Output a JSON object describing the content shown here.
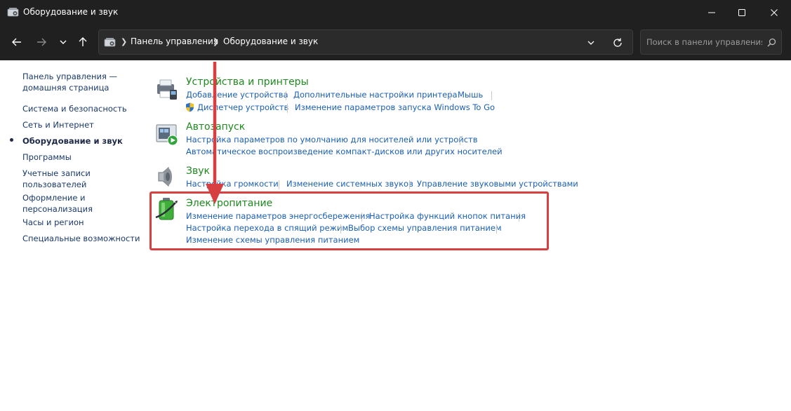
{
  "window": {
    "title": "Оборудование и звук"
  },
  "address": {
    "breadcrumbs": [
      "Панель управления",
      "Оборудование и звук"
    ]
  },
  "search": {
    "placeholder": "Поиск в панели управления"
  },
  "sidebar": {
    "items": [
      {
        "label": "Панель управления —\nдомашняя страница"
      },
      {
        "label": "Система и безопасность"
      },
      {
        "label": "Сеть и Интернет"
      },
      {
        "label": "Оборудование и звук",
        "current": true
      },
      {
        "label": "Программы"
      },
      {
        "label": "Учетные записи\nпользователей"
      },
      {
        "label": "Оформление и\nперсонализация"
      },
      {
        "label": "Часы и регион"
      },
      {
        "label": "Специальные возможности"
      }
    ]
  },
  "categories": [
    {
      "title": "Устройства и принтеры",
      "links": [
        "Добавление устройства",
        "Дополнительные настройки принтера",
        "Мышь",
        "Диспетчер устройств",
        "Изменение параметров запуска Windows To Go"
      ]
    },
    {
      "title": "Автозапуск",
      "links": [
        "Настройка параметров по умолчанию для носителей или устройств",
        "Автоматическое воспроизведение компакт-дисков или других носителей"
      ]
    },
    {
      "title": "Звук",
      "links": [
        "Настройка громкости",
        "Изменение системных звуков",
        "Управление звуковыми устройствами"
      ]
    },
    {
      "title": "Электропитание",
      "links": [
        "Изменение параметров энергосбережения",
        "Настройка функций кнопок питания",
        "Настройка перехода в спящий режим",
        "Выбор схемы управления питанием",
        "Изменение схемы управления питанием"
      ]
    }
  ],
  "colors": {
    "accent_link": "#1a5fb4",
    "category_title": "#1e8a1e",
    "annotation": "#d64040",
    "chrome": "#202020"
  }
}
